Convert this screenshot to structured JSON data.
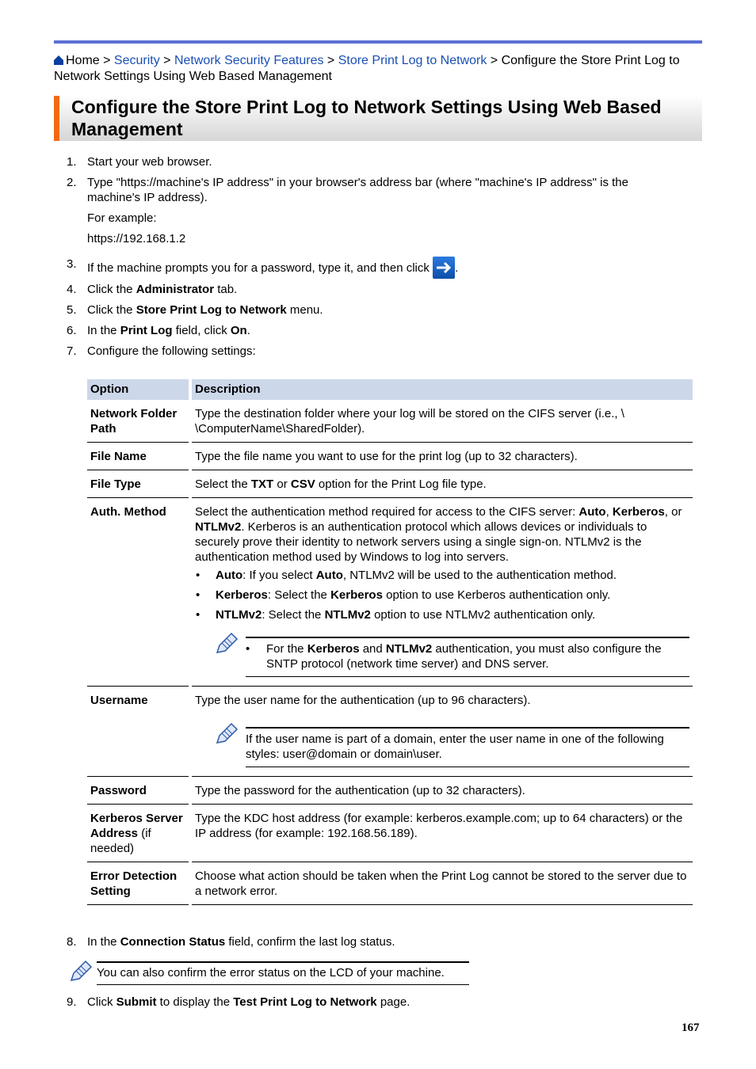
{
  "breadcrumb": {
    "home": "Home",
    "sep": " > ",
    "links": [
      "Security",
      "Network Security Features",
      "Store Print Log to Network"
    ],
    "current": "Configure the Store Print Log to Network Settings Using Web Based Management"
  },
  "title": "Configure the Store Print Log to Network Settings Using Web Based Management",
  "steps": {
    "s1": {
      "num": "1.",
      "text": "Start your web browser."
    },
    "s2": {
      "num": "2.",
      "text": "Type \"https://machine's IP address\" in your browser's address bar (where \"machine's IP address\" is the machine's IP address).",
      "example_label": "For example:",
      "example_value": "https://192.168.1.2"
    },
    "s3": {
      "num": "3.",
      "text": "If the machine prompts you for a password, type it, and then click",
      "after": "."
    },
    "s4": {
      "num": "4.",
      "pre": "Click the ",
      "bold": "Administrator",
      "post": " tab."
    },
    "s5": {
      "num": "5.",
      "pre": "Click the ",
      "bold": "Store Print Log to Network",
      "post": " menu."
    },
    "s6": {
      "num": "6.",
      "pre": "In the ",
      "bold": "Print Log",
      "mid": " field, click ",
      "bold2": "On",
      "post": "."
    },
    "s7": {
      "num": "7.",
      "text": "Configure the following settings:"
    },
    "s8": {
      "num": "8.",
      "pre": "In the ",
      "bold": "Connection Status",
      "post": " field, confirm the last log status."
    },
    "s9": {
      "num": "9.",
      "pre": "Click ",
      "bold": "Submit",
      "mid": " to display the ",
      "bold2": "Test Print Log to Network",
      "post": " page."
    }
  },
  "table": {
    "headers": [
      "Option",
      "Description"
    ],
    "rows": {
      "folder": {
        "option": "Network Folder Path",
        "desc": "Type the destination folder where your log will be stored on the CIFS server (i.e., \\ \\ComputerName\\SharedFolder)."
      },
      "filename": {
        "option": "File Name",
        "desc": "Type the file name you want to use for the print log (up to 32 characters)."
      },
      "filetype": {
        "option": "File Type",
        "pre": "Select the ",
        "b1": "TXT",
        "mid": " or ",
        "b2": "CSV",
        "post": " option for the Print Log file type."
      },
      "auth": {
        "option": "Auth. Method",
        "p1": "Select the authentication method required for access to the CIFS server: ",
        "b1": "Auto",
        "c1": ", ",
        "b2": "Kerberos",
        "c2": ", or ",
        "b3": "NTLMv2",
        "p2": ". Kerberos is an authentication protocol which allows devices or individuals to securely prove their identity to network servers using a single sign-on. NTLMv2 is the authentication method used by Windows to log into servers.",
        "bullets": {
          "auto": {
            "b": "Auto",
            "t1": ": If you select ",
            "b2": "Auto",
            "t2": ", NTLMv2 will be used to the authentication method."
          },
          "kerberos": {
            "b": "Kerberos",
            "t1": ": Select the ",
            "b2": "Kerberos",
            "t2": " option to use Kerberos authentication only."
          },
          "ntlm": {
            "b": "NTLMv2",
            "t1": ": Select the ",
            "b2": "NTLMv2",
            "t2": " option to use NTLMv2 authentication only."
          }
        },
        "note": {
          "pre": "For the ",
          "b1": "Kerberos",
          "mid": " and ",
          "b2": "NTLMv2",
          "post": " authentication, you must also configure the SNTP protocol (network time server) and DNS server."
        }
      },
      "username": {
        "option": "Username",
        "desc": "Type the user name for the authentication (up to 96 characters).",
        "note": "If the user name is part of a domain, enter the user name in one of the following styles: user@domain or domain\\user."
      },
      "password": {
        "option": "Password",
        "desc": "Type the password for the authentication (up to 32 characters)."
      },
      "kerberos": {
        "option": "Kerberos Server Address",
        "option_suffix": " (if needed)",
        "desc": "Type the KDC host address (for example: kerberos.example.com; up to 64 characters) or the IP address (for example: 192.168.56.189)."
      },
      "error": {
        "option": "Error Detection Setting",
        "desc": "Choose what action should be taken when the Print Log cannot be stored to the server due to a network error."
      }
    }
  },
  "note_main": "You can also confirm the error status on the LCD of your machine.",
  "page_number": "167",
  "colors": {
    "accent_bar": "#5b6fd6",
    "title_stripe": "#f26a10",
    "link": "#1a4fb4",
    "table_header": "#cdd7ea"
  }
}
